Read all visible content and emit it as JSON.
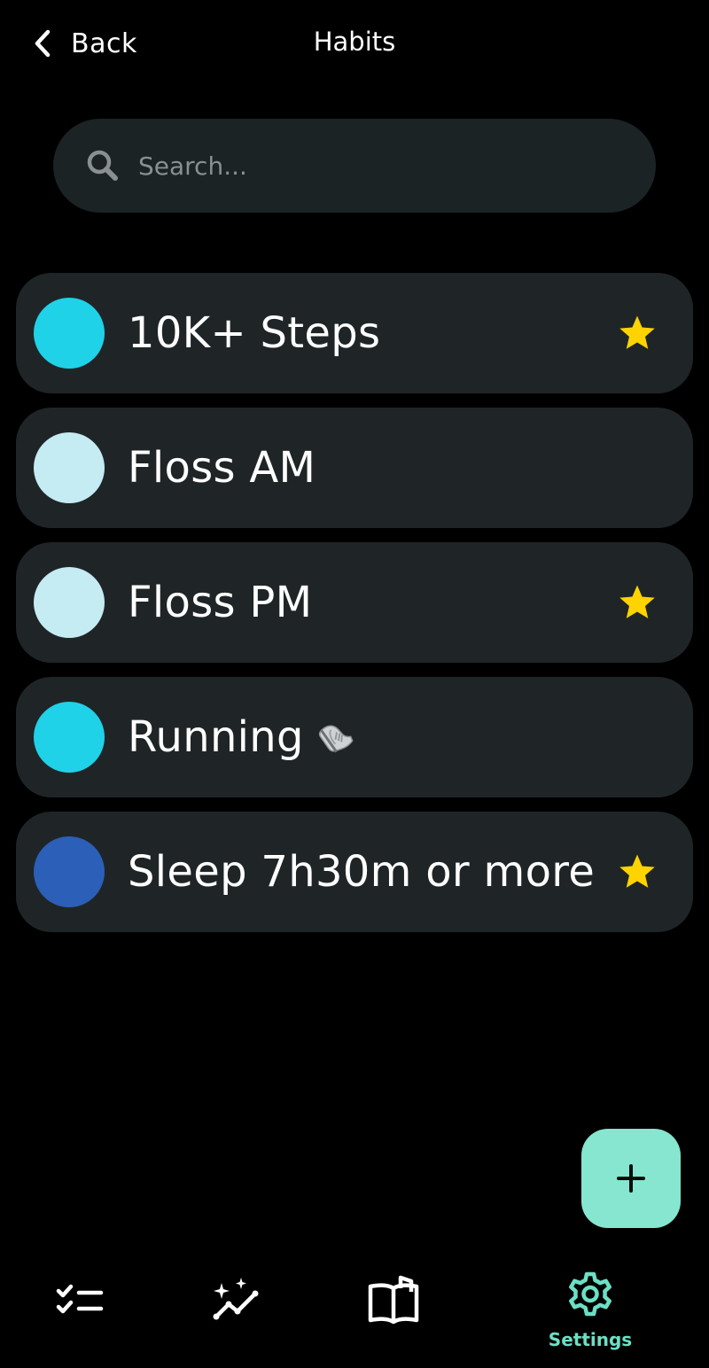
{
  "header": {
    "back_label": "Back",
    "title": "Habits"
  },
  "search": {
    "placeholder": "Search...",
    "value": "",
    "icon": "search-icon"
  },
  "habits": [
    {
      "name": "10K+ Steps",
      "color": "#1fd2e8",
      "starred": true
    },
    {
      "name": "Floss AM",
      "color": "#c5ebf3",
      "starred": false
    },
    {
      "name": "Floss PM",
      "color": "#c5ebf3",
      "starred": true
    },
    {
      "name": "Running",
      "emoji": "running-shoe-icon",
      "color": "#1fd2e8",
      "starred": false
    },
    {
      "name": "Sleep 7h30m or more",
      "color": "#2c5fb8",
      "starred": true
    }
  ],
  "colors": {
    "background": "#000000",
    "card": "#1f2527",
    "search_bg": "#1b2324",
    "accent": "#86e6cf",
    "active_nav": "#6be0c4",
    "star": "#ffd300"
  },
  "fab": {
    "icon": "plus-icon"
  },
  "bottom_nav": {
    "items": [
      {
        "icon": "checklist-icon",
        "label": ""
      },
      {
        "icon": "trend-sparkle-icon",
        "label": ""
      },
      {
        "icon": "open-book-icon",
        "label": ""
      },
      {
        "icon": "gear-icon",
        "label": "Settings",
        "active": true
      }
    ]
  }
}
